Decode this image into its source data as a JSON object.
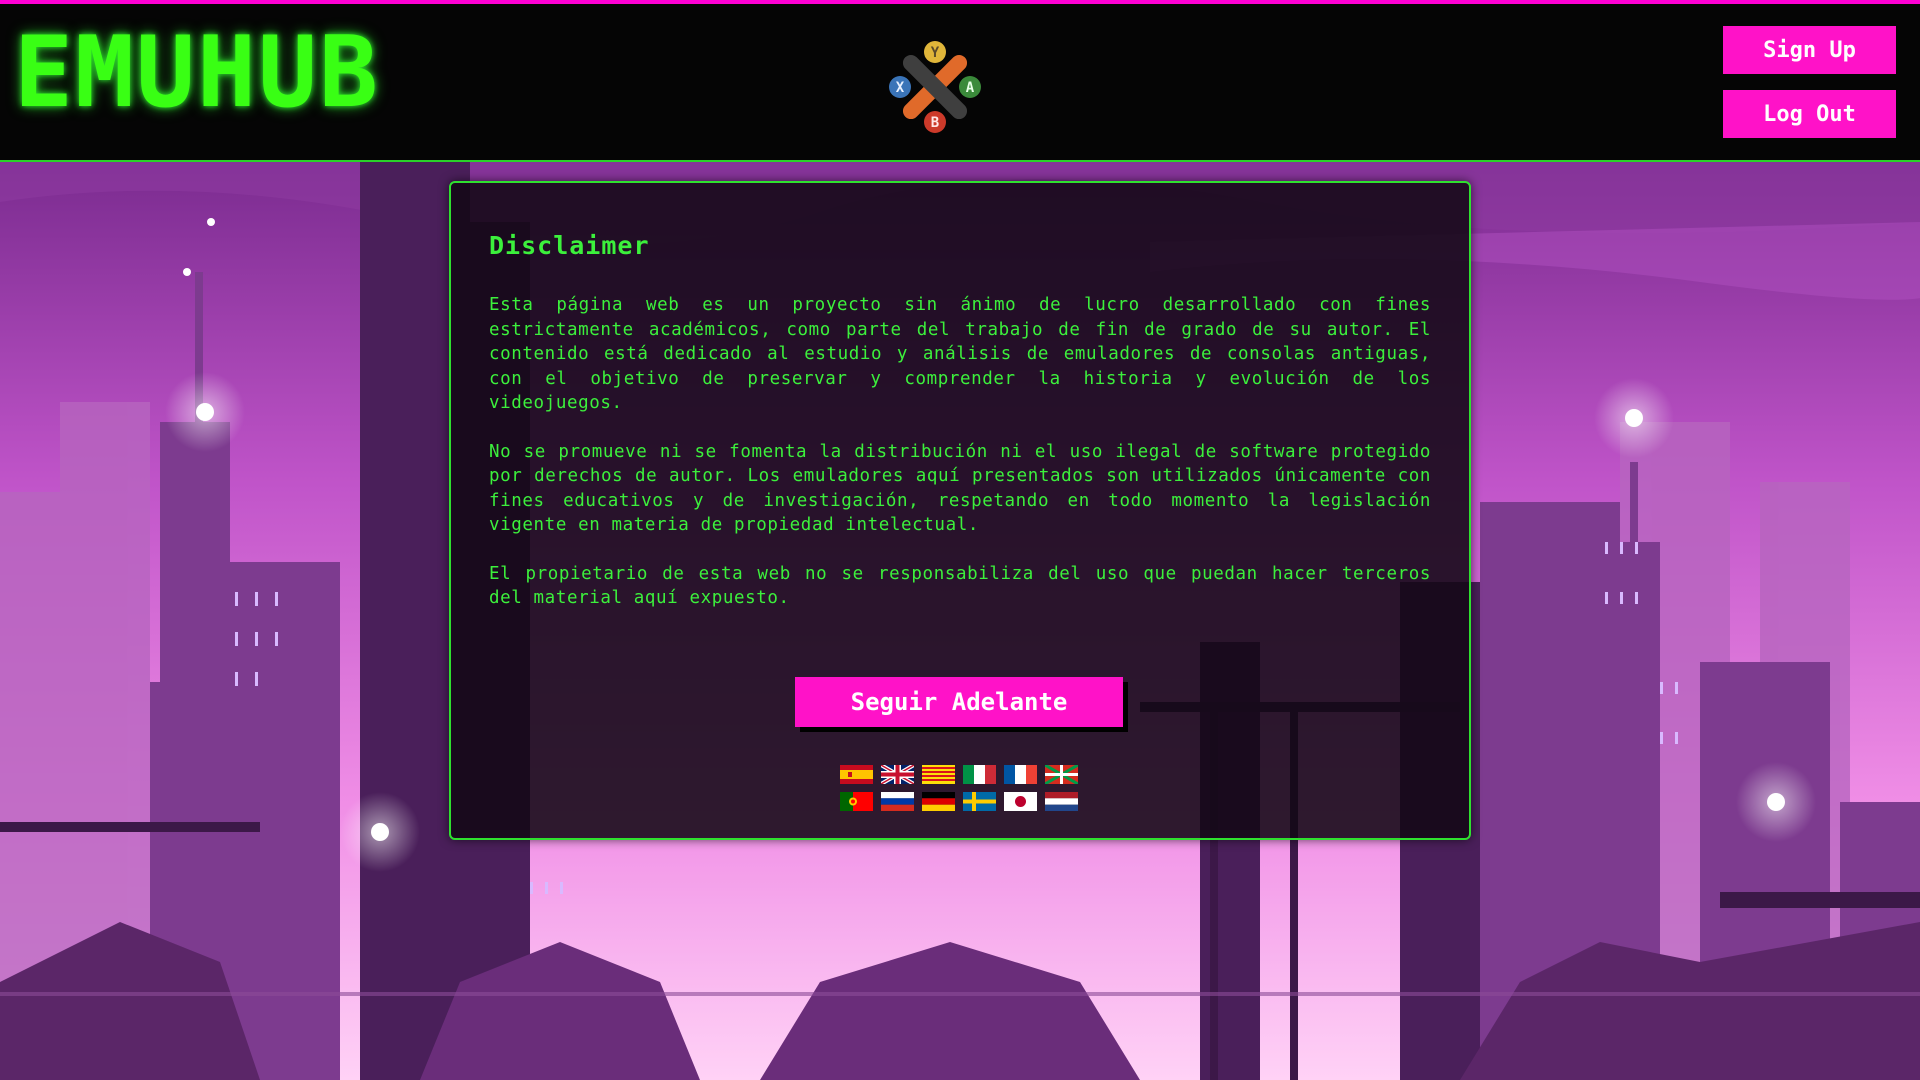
{
  "header": {
    "logo_text": "EMUHUB",
    "gamepad_buttons": [
      "Y",
      "A",
      "X",
      "B"
    ],
    "signup_label": "Sign Up",
    "logout_label": "Log Out"
  },
  "disclaimer": {
    "title": "Disclaimer",
    "paragraphs": [
      "Esta página web es un proyecto sin ánimo de lucro desarrollado con fines estrictamente académicos, como parte del trabajo de fin de grado de su autor. El contenido está dedicado al estudio y análisis de emuladores de consolas antiguas, con el objetivo de preservar y comprender la historia y evolución de los videojuegos.",
      "No se promueve ni se fomenta la distribución ni el uso ilegal de software protegido por derechos de autor. Los emuladores aquí presentados son utilizados únicamente con fines educativos y de investigación, respetando en todo momento la legislación vigente en materia de propiedad intelectual.",
      "El propietario de esta web no se responsabiliza del uso que puedan hacer terceros del material aquí expuesto."
    ],
    "button_label": "Seguir Adelante"
  },
  "languages": [
    {
      "name": "spain-flag-icon"
    },
    {
      "name": "uk-flag-icon"
    },
    {
      "name": "catalonia-flag-icon"
    },
    {
      "name": "italy-flag-icon"
    },
    {
      "name": "france-flag-icon"
    },
    {
      "name": "basque-flag-icon"
    },
    {
      "name": "portugal-flag-icon"
    },
    {
      "name": "russia-flag-icon"
    },
    {
      "name": "germany-flag-icon"
    },
    {
      "name": "sweden-flag-icon"
    },
    {
      "name": "japan-flag-icon"
    },
    {
      "name": "netherlands-flag-icon"
    }
  ],
  "colors": {
    "accent_pink": "#ff12c8",
    "neon_green": "#3cf03c",
    "header_bg": "#050505"
  }
}
